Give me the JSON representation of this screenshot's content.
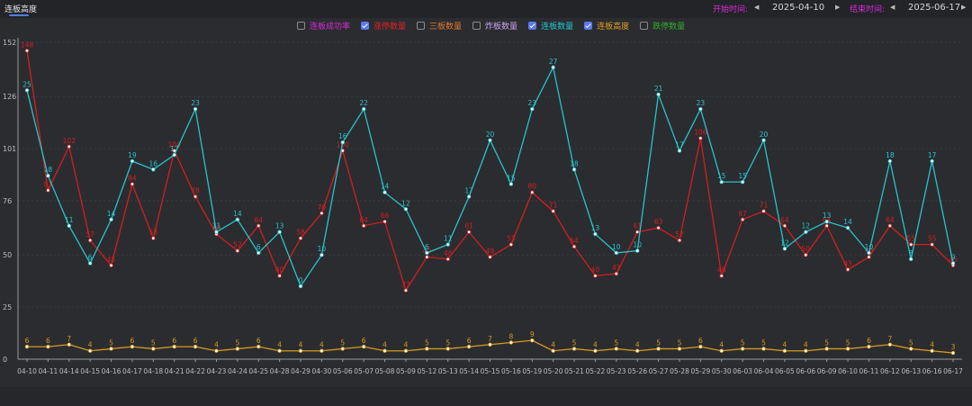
{
  "tabs": [
    {
      "label": "连板高度",
      "active": true
    }
  ],
  "date_range": {
    "start_label": "开始时间:",
    "start_value": "2025-04-10",
    "end_label": "结束时间:",
    "end_value": "2025-06-17"
  },
  "legend": [
    {
      "label": "连板成功率",
      "checked": false,
      "color": "#d92bd9"
    },
    {
      "label": "涨停数量",
      "checked": true,
      "color": "#e02424"
    },
    {
      "label": "三板数量",
      "checked": false,
      "color": "#e07a2e"
    },
    {
      "label": "炸板数量",
      "checked": false,
      "color": "#c7a4f0"
    },
    {
      "label": "连板数量",
      "checked": true,
      "color": "#21c8d0"
    },
    {
      "label": "连板高度",
      "checked": true,
      "color": "#e0a020"
    },
    {
      "label": "跌停数量",
      "checked": false,
      "color": "#2fae2f"
    }
  ],
  "chart_data": {
    "type": "line",
    "ylim": [
      0,
      152
    ],
    "yticks": [
      0,
      25,
      50,
      76,
      101,
      126,
      152
    ],
    "grid": true,
    "categories": [
      "04-10",
      "04-11",
      "04-14",
      "04-15",
      "04-16",
      "04-17",
      "04-18",
      "04-21",
      "04-22",
      "04-23",
      "04-24",
      "04-25",
      "04-28",
      "04-29",
      "04-30",
      "05-06",
      "05-07",
      "05-08",
      "05-09",
      "05-12",
      "05-13",
      "05-14",
      "05-15",
      "05-16",
      "05-19",
      "05-20",
      "05-21",
      "05-22",
      "05-23",
      "05-26",
      "05-27",
      "05-28",
      "05-29",
      "05-30",
      "06-03",
      "06-04",
      "06-05",
      "06-06",
      "06-09",
      "06-10",
      "06-11",
      "06-12",
      "06-13",
      "06-16",
      "06-17"
    ],
    "series": [
      {
        "name": "涨停数量",
        "color": "#d21f1f",
        "values": [
          148,
          81,
          102,
          57,
          45,
          84,
          58,
          100,
          78,
          60,
          52,
          64,
          40,
          58,
          70,
          100,
          64,
          66,
          33,
          49,
          48,
          61,
          49,
          55,
          80,
          71,
          54,
          40,
          41,
          61,
          63,
          57,
          106,
          40,
          67,
          71,
          64,
          50,
          64,
          43,
          49,
          64,
          55,
          55,
          45
        ],
        "labels": [
          "148",
          "81",
          "102",
          "57",
          "45",
          "84",
          "58",
          "100",
          "78",
          "60",
          "52",
          "64",
          "40",
          "58",
          "70",
          "100",
          "64",
          "66",
          "33",
          "49",
          "48",
          "61",
          "49",
          "55",
          "80",
          "71",
          "54",
          "40",
          "41",
          "61",
          "63",
          "57",
          "106",
          "40",
          "67",
          "71",
          "64",
          "50",
          "64",
          "43",
          "49",
          "64",
          "55",
          "55",
          "45"
        ]
      },
      {
        "name": "连板数量",
        "color": "#27c4cc",
        "values": [
          129,
          88,
          64,
          46,
          67,
          95,
          91,
          98,
          120,
          61,
          67,
          51,
          61,
          35,
          50,
          104,
          120,
          80,
          72,
          51,
          55,
          78,
          105,
          84,
          120,
          140,
          91,
          60,
          51,
          52,
          127,
          100,
          120,
          85,
          85,
          105,
          53,
          61,
          66,
          63,
          51,
          95,
          48,
          95,
          46
        ],
        "labels": [
          "25",
          "18",
          "11",
          "6",
          "14",
          "19",
          "16",
          "17",
          "23",
          "11",
          "14",
          "6",
          "13",
          "0",
          "10",
          "16",
          "22",
          "14",
          "12",
          "6",
          "11",
          "17",
          "20",
          "15",
          "23",
          "27",
          "18",
          "13",
          "10",
          "10",
          "21",
          "17",
          "23",
          "15",
          "15",
          "20",
          "12",
          "12",
          "13",
          "14",
          "10",
          "18",
          "8",
          "17",
          "9"
        ]
      },
      {
        "name": "连板高度",
        "color": "#d99a1c",
        "values": [
          6,
          6,
          7,
          4,
          5,
          6,
          5,
          6,
          6,
          4,
          5,
          6,
          4,
          4,
          4,
          5,
          6,
          4,
          4,
          5,
          5,
          6,
          7,
          8,
          9,
          4,
          5,
          4,
          5,
          4,
          5,
          5,
          6,
          4,
          5,
          5,
          4,
          4,
          5,
          5,
          6,
          7,
          5,
          4,
          3
        ],
        "labels": [
          "6",
          "6",
          "7",
          "4",
          "5",
          "6",
          "5",
          "6",
          "6",
          "4",
          "5",
          "6",
          "4",
          "4",
          "4",
          "5",
          "6",
          "4",
          "4",
          "5",
          "5",
          "6",
          "7",
          "8",
          "9",
          "4",
          "5",
          "4",
          "5",
          "4",
          "5",
          "5",
          "6",
          "4",
          "5",
          "5",
          "4",
          "4",
          "5",
          "5",
          "6",
          "7",
          "5",
          "4",
          "3"
        ]
      }
    ]
  }
}
